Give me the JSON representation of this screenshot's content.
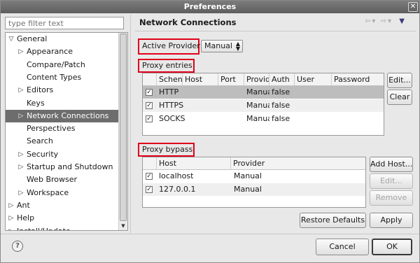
{
  "window": {
    "title": "Preferences"
  },
  "filter": {
    "placeholder": "type filter text"
  },
  "tree": {
    "items": [
      {
        "label": "General",
        "depth": 0,
        "toggle": "expanded"
      },
      {
        "label": "Appearance",
        "depth": 1,
        "toggle": "collapsed"
      },
      {
        "label": "Compare/Patch",
        "depth": 1,
        "toggle": "none"
      },
      {
        "label": "Content Types",
        "depth": 1,
        "toggle": "none"
      },
      {
        "label": "Editors",
        "depth": 1,
        "toggle": "collapsed"
      },
      {
        "label": "Keys",
        "depth": 1,
        "toggle": "none"
      },
      {
        "label": "Network Connections",
        "depth": 1,
        "toggle": "collapsed",
        "selected": true
      },
      {
        "label": "Perspectives",
        "depth": 1,
        "toggle": "none"
      },
      {
        "label": "Search",
        "depth": 1,
        "toggle": "none"
      },
      {
        "label": "Security",
        "depth": 1,
        "toggle": "collapsed"
      },
      {
        "label": "Startup and Shutdown",
        "depth": 1,
        "toggle": "collapsed"
      },
      {
        "label": "Web Browser",
        "depth": 1,
        "toggle": "none"
      },
      {
        "label": "Workspace",
        "depth": 1,
        "toggle": "collapsed"
      },
      {
        "label": "Ant",
        "depth": 0,
        "toggle": "collapsed"
      },
      {
        "label": "Help",
        "depth": 0,
        "toggle": "collapsed"
      },
      {
        "label": "Install/Update",
        "depth": 0,
        "toggle": "collapsed"
      }
    ]
  },
  "page": {
    "title": "Network Connections",
    "active_provider_label": "Active Provider:",
    "active_provider_value": "Manual",
    "proxy_entries_label": "Proxy entries",
    "proxy_bypass_label": "Proxy bypass"
  },
  "proxy_entries": {
    "columns": [
      "Schen",
      "Host",
      "Port",
      "Provid",
      "Auth",
      "User",
      "Password"
    ],
    "rows": [
      {
        "checked": true,
        "scheme": "HTTP",
        "host": "",
        "port": "",
        "provider": "Manua",
        "auth": "false",
        "user": "",
        "password": ""
      },
      {
        "checked": true,
        "scheme": "HTTPS",
        "host": "",
        "port": "",
        "provider": "Manua",
        "auth": "false",
        "user": "",
        "password": ""
      },
      {
        "checked": true,
        "scheme": "SOCKS",
        "host": "",
        "port": "",
        "provider": "Manua",
        "auth": "false",
        "user": "",
        "password": ""
      }
    ],
    "edit_button": "Edit...",
    "clear_button": "Clear"
  },
  "proxy_bypass": {
    "columns": [
      "Host",
      "Provider"
    ],
    "rows": [
      {
        "checked": true,
        "host": "localhost",
        "provider": "Manual"
      },
      {
        "checked": true,
        "host": "127.0.0.1",
        "provider": "Manual"
      }
    ],
    "add_host_button": "Add Host...",
    "edit_button": "Edit...",
    "remove_button": "Remove"
  },
  "buttons": {
    "restore_defaults": "Restore Defaults",
    "apply": "Apply",
    "cancel": "Cancel",
    "ok": "OK",
    "help_glyph": "?"
  },
  "icons": {
    "close": "close-icon",
    "back": "back-arrow-icon",
    "forward": "forward-arrow-icon",
    "view_menu": "view-menu-icon",
    "help": "help-icon"
  },
  "colors": {
    "highlight_box": "#e0001a",
    "tree_selection": "#6d6d6d",
    "table_selection": "#bdbdbd"
  }
}
